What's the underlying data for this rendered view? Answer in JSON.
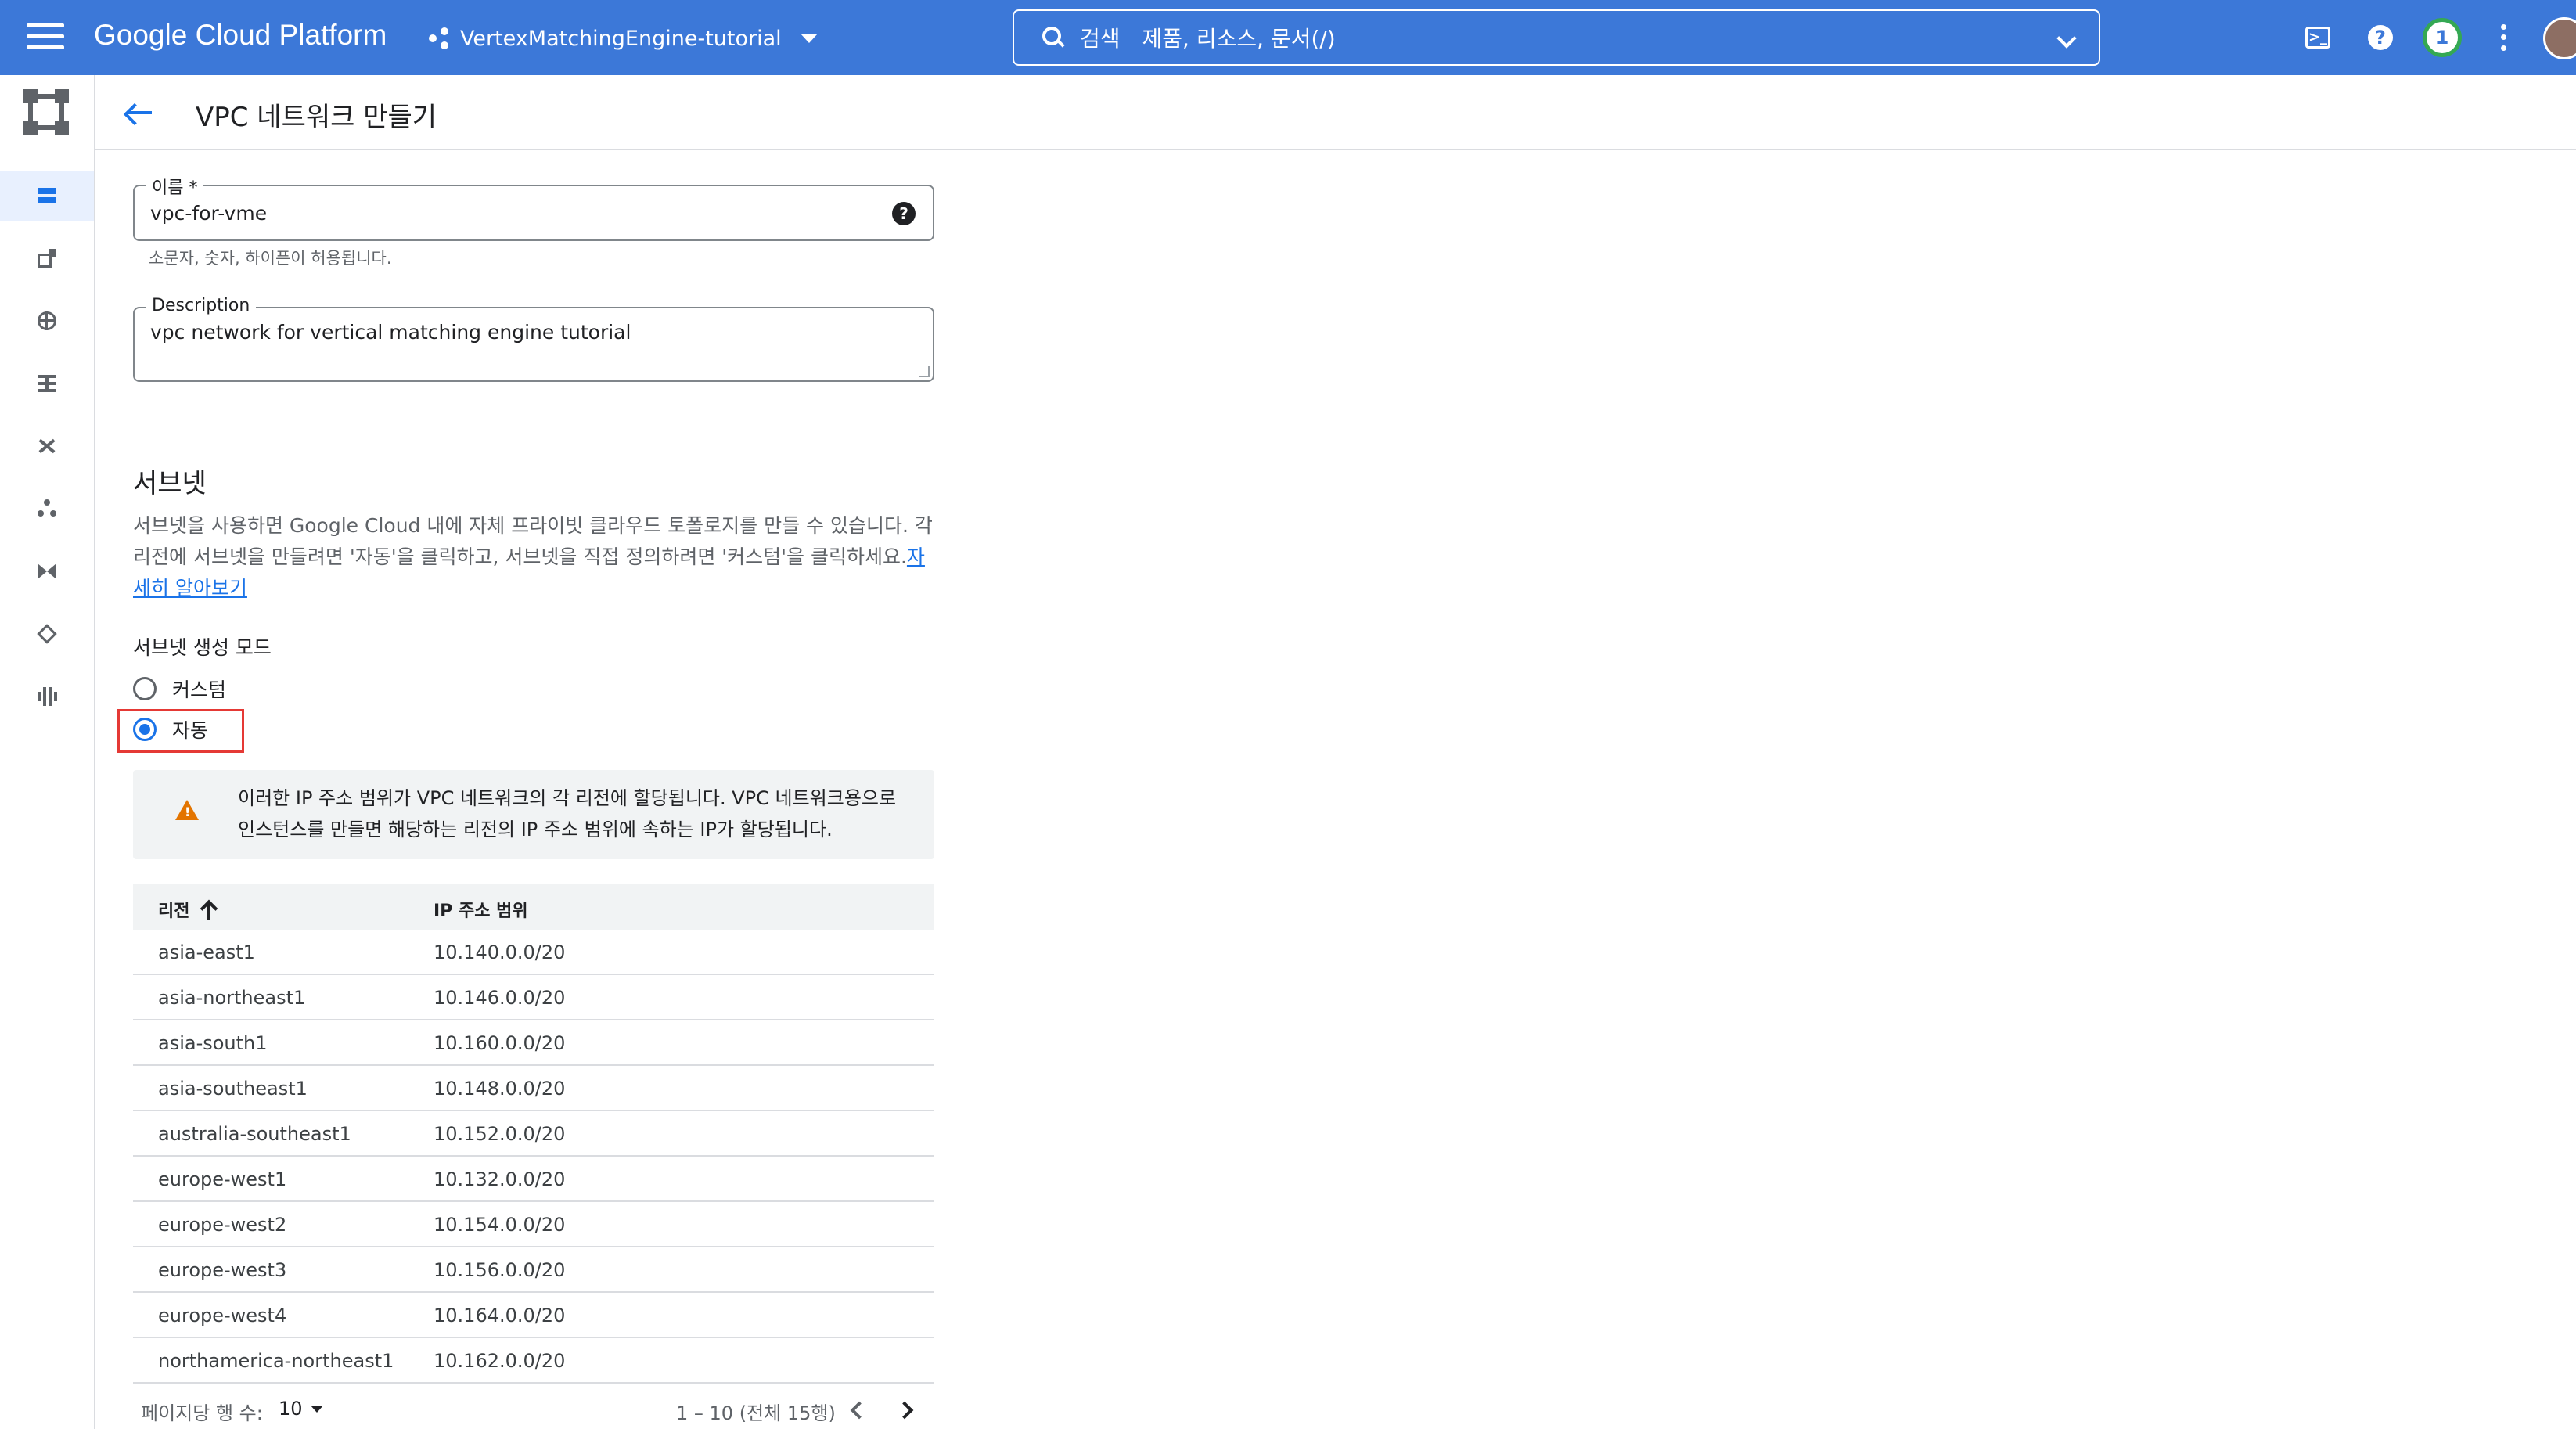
{
  "topbar": {
    "brand": "Google Cloud Platform",
    "project": "VertexMatchingEngine-tutorial",
    "search_label": "검색",
    "search_placeholder": "제품, 리소스, 문서(/)",
    "notification_count": "1"
  },
  "header": {
    "title": "VPC 네트워크 만들기"
  },
  "form": {
    "name_label": "이름 *",
    "name_value": "vpc-for-vme",
    "name_hint": "소문자, 숫자, 하이픈이 허용됩니다.",
    "description_label": "Description",
    "description_value": "vpc network for vertical matching engine tutorial"
  },
  "subnet": {
    "title": "서브넷",
    "description": "서브넷을 사용하면 Google Cloud 내에 자체 프라이빗 클라우드 토폴로지를 만들 수 있습니다. 각 리전에 서브넷을 만들려면 '자동'을 클릭하고, 서브넷을 직접 정의하려면 '커스텀'을 클릭하세요.",
    "learn_more": "자세히 알아보기",
    "mode_label": "서브넷 생성 모드",
    "mode_options": [
      "커스텀",
      "자동"
    ],
    "selected_mode": "자동",
    "warning": "이러한 IP 주소 범위가 VPC 네트워크의 각 리전에 할당됩니다. VPC 네트워크용으로 인스턴스를 만들면 해당하는 리전의 IP 주소 범위에 속하는 IP가 할당됩니다."
  },
  "table": {
    "col_region": "리전",
    "col_ip": "IP 주소 범위",
    "rows": [
      {
        "region": "asia-east1",
        "ip": "10.140.0.0/20"
      },
      {
        "region": "asia-northeast1",
        "ip": "10.146.0.0/20"
      },
      {
        "region": "asia-south1",
        "ip": "10.160.0.0/20"
      },
      {
        "region": "asia-southeast1",
        "ip": "10.148.0.0/20"
      },
      {
        "region": "australia-southeast1",
        "ip": "10.152.0.0/20"
      },
      {
        "region": "europe-west1",
        "ip": "10.132.0.0/20"
      },
      {
        "region": "europe-west2",
        "ip": "10.154.0.0/20"
      },
      {
        "region": "europe-west3",
        "ip": "10.156.0.0/20"
      },
      {
        "region": "europe-west4",
        "ip": "10.164.0.0/20"
      },
      {
        "region": "northamerica-northeast1",
        "ip": "10.162.0.0/20"
      }
    ]
  },
  "pager": {
    "rows_per_page_label": "페이지당 행 수:",
    "rows_per_page": "10",
    "range": "1 – 10 (전체 15행)"
  },
  "colors": {
    "topbar": "#3c78d8",
    "accent": "#1a73e8",
    "highlight_box": "#e53935",
    "warning": "#e37400"
  }
}
